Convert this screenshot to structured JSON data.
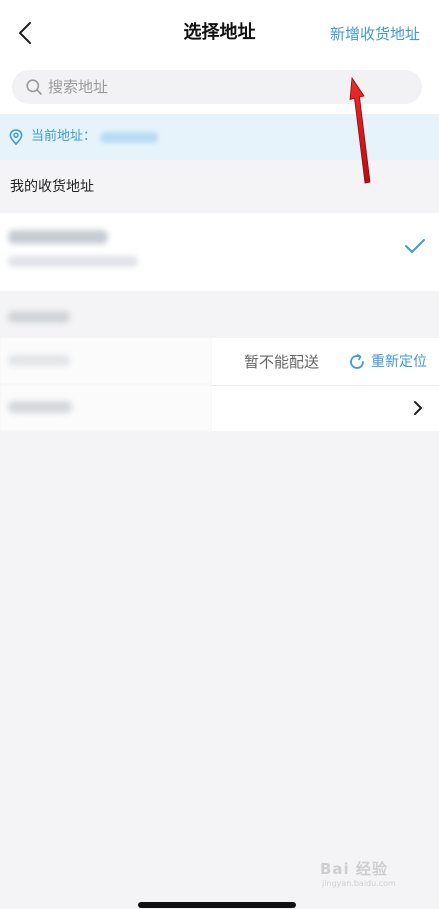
{
  "header": {
    "title": "选择地址",
    "add_label": "新增收货地址"
  },
  "search": {
    "placeholder": "搜索地址"
  },
  "current_location": {
    "label": "当前地址："
  },
  "my_addresses": {
    "section_title": "我的收货地址"
  },
  "nearby": {
    "status": "暂不能配送",
    "relocate_label": "重新定位"
  },
  "watermark": {
    "text": "Bai 经验",
    "sub": "jingyan.baidu.com"
  },
  "colors": {
    "accent": "#3e9ad8",
    "highlight_bg": "#e6f3fb",
    "annotation_arrow": "#e0141e"
  },
  "icons": [
    "back-icon",
    "search-icon",
    "location-pin-icon",
    "checkmark-icon",
    "refresh-icon",
    "chevron-right-icon"
  ]
}
